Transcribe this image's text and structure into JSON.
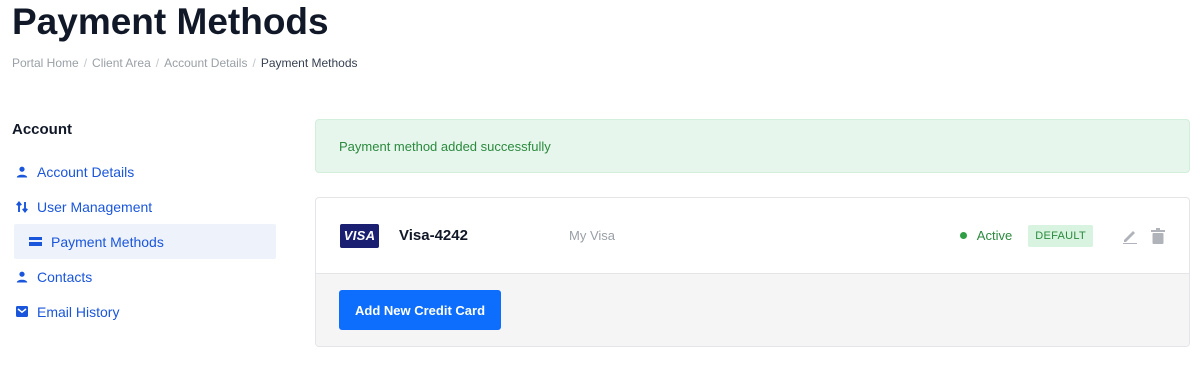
{
  "header": {
    "title": "Payment Methods"
  },
  "breadcrumb": {
    "items": [
      "Portal Home",
      "Client Area",
      "Account Details"
    ],
    "separator": "/",
    "current": "Payment Methods"
  },
  "sidebar": {
    "heading": "Account",
    "items": [
      {
        "label": "Account Details",
        "icon": "user-icon"
      },
      {
        "label": "User Management",
        "icon": "swap-arrows-icon"
      },
      {
        "label": "Payment Methods",
        "icon": "credit-card-icon",
        "active": true
      },
      {
        "label": "Contacts",
        "icon": "user-icon"
      },
      {
        "label": "Email History",
        "icon": "envelope-icon"
      }
    ]
  },
  "alert": {
    "message": "Payment method added successfully",
    "type": "success"
  },
  "payment_methods": [
    {
      "brand": "VISA",
      "name": "Visa-4242",
      "description": "My Visa",
      "status": "Active",
      "badge": "DEFAULT"
    }
  ],
  "actions": {
    "add_card_label": "Add New Credit Card"
  },
  "colors": {
    "accent": "#0d6efd",
    "link": "#1a56db",
    "success": "#2b8a3e",
    "alert_bg": "#e7f6ec",
    "visa": "#1a1f71"
  }
}
